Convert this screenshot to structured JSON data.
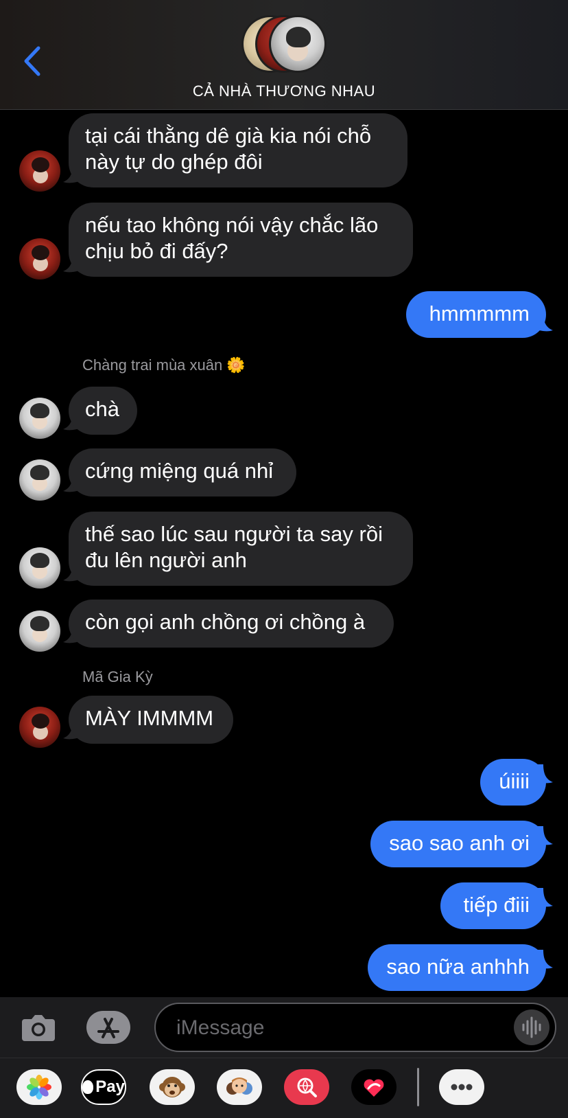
{
  "header": {
    "group_name": "CẢ NHÀ THƯƠNG NHAU",
    "back_icon": "chevron-left-icon"
  },
  "messages": [
    {
      "from": "them",
      "text_lines": [
        "tại cái thằng dê già kia nói chỗ",
        "này tự do ghép đôi"
      ]
    },
    {
      "from": "them",
      "text_lines": [
        "nếu tao không nói vậy chắc lão",
        "chịu bỏ đi đấy?"
      ]
    },
    {
      "from": "me",
      "text_lines": [
        "hmmmmm"
      ]
    },
    {
      "sender_label": "Chàng trai mùa xuân 🌼"
    },
    {
      "from": "them",
      "text_lines": [
        "chà"
      ]
    },
    {
      "from": "them",
      "text_lines": [
        "cứng miệng quá nhỉ"
      ]
    },
    {
      "from": "them",
      "text_lines": [
        "thế sao lúc sau người ta say rồi",
        "đu lên người anh"
      ]
    },
    {
      "from": "them",
      "text_lines": [
        "còn gọi anh chồng ơi chồng à"
      ]
    },
    {
      "sender_label": "Mã Gia Kỳ"
    },
    {
      "from": "them",
      "text_lines": [
        "MÀY IMMMM"
      ]
    },
    {
      "from": "me",
      "text_lines": [
        "úiiii"
      ]
    },
    {
      "from": "me",
      "text_lines": [
        "sao sao anh ơi"
      ]
    },
    {
      "from": "me",
      "text_lines": [
        "tiếp điii"
      ]
    },
    {
      "from": "me",
      "text_lines": [
        "sao nữa anhhh"
      ]
    }
  ],
  "composer": {
    "placeholder": "iMessage",
    "camera_icon": "camera-icon",
    "apps_icon": "app-store-icon",
    "audio_icon": "waveform-icon"
  },
  "app_drawer": {
    "apps": [
      "photos-icon",
      "apple-pay-icon",
      "memoji-monkey-icon",
      "memoji-icon",
      "image-search-icon",
      "digital-touch-icon",
      "more-icon"
    ],
    "pay_label": "Pay"
  },
  "colors": {
    "outgoing_bubble": "#3478f6",
    "incoming_bubble": "#262628",
    "accent_blue": "#3478f6"
  }
}
